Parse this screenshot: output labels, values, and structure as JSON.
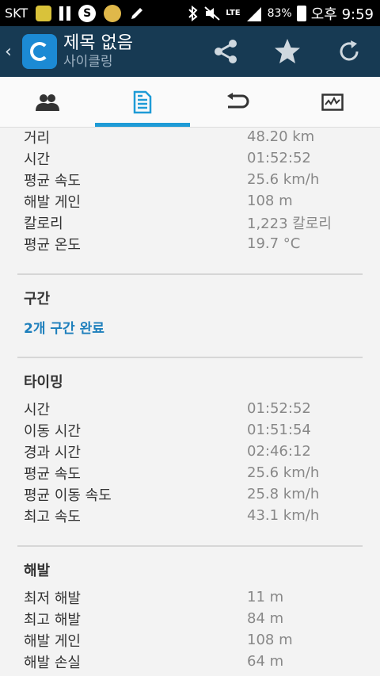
{
  "status_bar": {
    "carrier": "SKT",
    "lte": "LTE",
    "battery": "83%",
    "time": "오후 9:59"
  },
  "app_bar": {
    "title": "제목 없음",
    "subtitle": "사이클링",
    "colors": {
      "background": "#173a53",
      "app_icon": "#1c8ad4"
    },
    "actions": [
      "share-icon",
      "star-icon",
      "refresh-icon"
    ]
  },
  "tabs": [
    {
      "icon": "people-icon",
      "active": false
    },
    {
      "icon": "document-icon",
      "active": true
    },
    {
      "icon": "loop-icon",
      "active": false
    },
    {
      "icon": "chart-icon",
      "active": false
    }
  ],
  "accent_color": "#1e9bd6",
  "summary": [
    {
      "label": "거리",
      "value": "48.20 km"
    },
    {
      "label": "시간",
      "value": "01:52:52"
    },
    {
      "label": "평균 속도",
      "value": "25.6 km/h"
    },
    {
      "label": "해발 게인",
      "value": "108 m"
    },
    {
      "label": "칼로리",
      "value": "1,223 칼로리"
    },
    {
      "label": "평균 온도",
      "value": "19.7 °C"
    }
  ],
  "laps": {
    "title": "구간",
    "link": "2개 구간 완료"
  },
  "timing": {
    "title": "타이밍",
    "rows": [
      {
        "label": "시간",
        "value": "01:52:52"
      },
      {
        "label": "이동 시간",
        "value": "01:51:54"
      },
      {
        "label": "경과 시간",
        "value": "02:46:12"
      },
      {
        "label": "평균 속도",
        "value": "25.6 km/h"
      },
      {
        "label": "평균 이동 속도",
        "value": "25.8 km/h"
      },
      {
        "label": "최고 속도",
        "value": "43.1 km/h"
      }
    ]
  },
  "elevation": {
    "title": "해발",
    "rows": [
      {
        "label": "최저 해발",
        "value": "11 m"
      },
      {
        "label": "최고 해발",
        "value": "84 m"
      },
      {
        "label": "해발 게인",
        "value": "108 m"
      },
      {
        "label": "해발 손실",
        "value": "64 m"
      }
    ]
  }
}
